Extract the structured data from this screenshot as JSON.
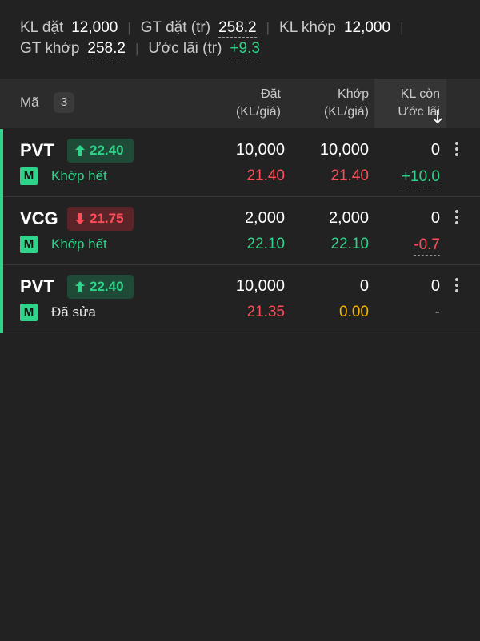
{
  "summary": {
    "kl_dat_label": "KL đặt",
    "kl_dat_value": "12,000",
    "gt_dat_label": "GT đặt (tr)",
    "gt_dat_value": "258.2",
    "kl_khop_label": "KL khớp",
    "kl_khop_value": "12,000",
    "gt_khop_label": "GT khớp",
    "gt_khop_value": "258.2",
    "uoc_lai_label": "Ước lãi (tr)",
    "uoc_lai_value": "+9.3"
  },
  "header": {
    "ma_label": "Mã",
    "count": "3",
    "dat_line1": "Đặt",
    "dat_line2": "(KL/giá)",
    "khop_line1": "Khớp",
    "khop_line2": "(KL/giá)",
    "klcon_line1": "KL còn",
    "klcon_line2": "Ước lãi"
  },
  "orders": [
    {
      "symbol": "PVT",
      "price": "22.40",
      "direction": "up",
      "type_badge": "M",
      "status": "Khớp hết",
      "dat_kl": "10,000",
      "dat_gia": "21.40",
      "khop_kl": "10,000",
      "khop_gia": "21.40",
      "kl_con": "0",
      "uoc_lai": "+10.0"
    },
    {
      "symbol": "VCG",
      "price": "21.75",
      "direction": "down",
      "type_badge": "M",
      "status": "Khớp hết",
      "dat_kl": "2,000",
      "dat_gia": "22.10",
      "khop_kl": "2,000",
      "khop_gia": "22.10",
      "kl_con": "0",
      "uoc_lai": "-0.7"
    },
    {
      "symbol": "PVT",
      "price": "22.40",
      "direction": "up",
      "type_badge": "M",
      "status": "Đã sửa",
      "dat_kl": "10,000",
      "dat_gia": "21.35",
      "khop_kl": "0",
      "khop_gia": "0.00",
      "kl_con": "0",
      "uoc_lai": "-"
    }
  ],
  "colors": {
    "background": "#222222",
    "header_bg": "#2c2c2c",
    "up_green": "#2fd48a",
    "down_red": "#ff4d5a",
    "pending_orange": "#f5b400"
  },
  "icons": {
    "up_arrow": "arrow-up-icon",
    "down_arrow": "arrow-down-icon",
    "sort": "sort-down-icon",
    "more": "kebab-menu-icon"
  }
}
